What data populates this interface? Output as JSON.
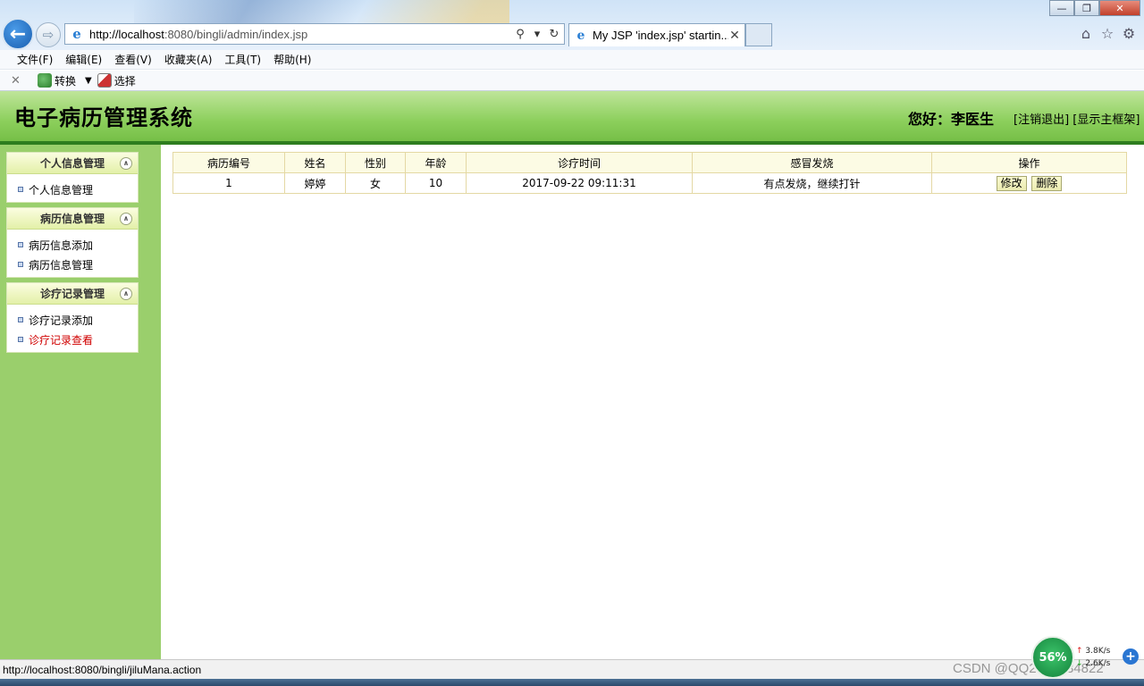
{
  "browser": {
    "url_prefix": "http://localhost",
    "url_rest": ":8080/bingli/admin/index.jsp",
    "tab_title": "My JSP 'index.jsp' startin...",
    "menu": [
      "文件(F)",
      "编辑(E)",
      "查看(V)",
      "收藏夹(A)",
      "工具(T)",
      "帮助(H)"
    ],
    "commands": {
      "convert": "转换",
      "select": "选择"
    },
    "status_url": "http://localhost:8080/bingli/jiluMana.action"
  },
  "header": {
    "title": "电子病历管理系统",
    "greeting": "您好：李医生",
    "logout_link": "[注销退出]",
    "show_frame_link": "[显示主框架]"
  },
  "sidebar": {
    "groups": [
      {
        "title": "个人信息管理",
        "items": [
          "个人信息管理"
        ]
      },
      {
        "title": "病历信息管理",
        "items": [
          "病历信息添加",
          "病历信息管理"
        ]
      },
      {
        "title": "诊疗记录管理",
        "items": [
          "诊疗记录添加",
          "诊疗记录查看"
        ]
      }
    ]
  },
  "table": {
    "headers": [
      "病历编号",
      "姓名",
      "性别",
      "年龄",
      "诊疗时间",
      "感冒发烧",
      "操作"
    ],
    "rows": [
      {
        "id": "1",
        "name": "婷婷",
        "sex": "女",
        "age": "10",
        "time": "2017-09-22 09:11:31",
        "note": "有点发烧，继续打针",
        "edit": "修改",
        "delete": "删除"
      }
    ]
  },
  "widget": {
    "percent": "56%",
    "up": "3.8K/s",
    "down": "2.6K/s"
  },
  "watermark": "CSDN @QQ2892034822"
}
